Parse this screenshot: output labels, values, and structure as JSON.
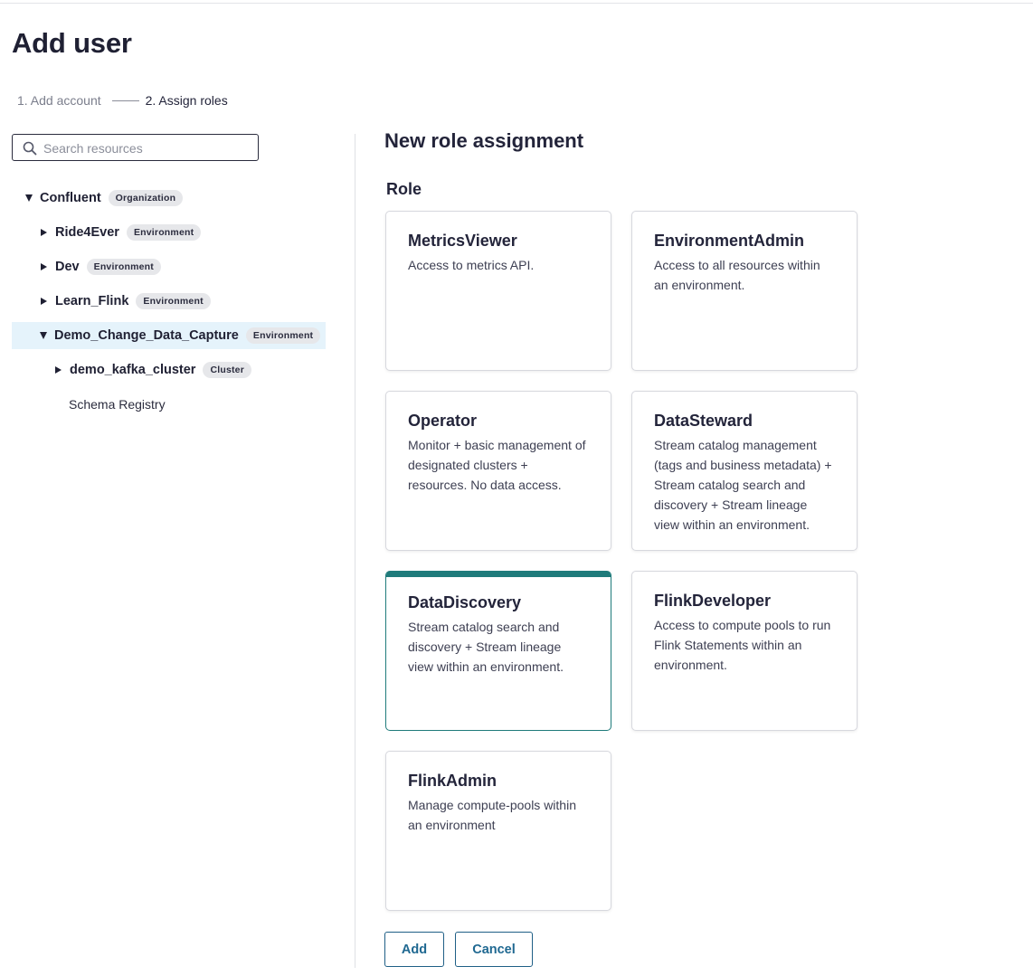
{
  "page": {
    "title": "Add user"
  },
  "stepper": {
    "step1": "1. Add account",
    "step2": "2. Assign roles"
  },
  "search": {
    "placeholder": "Search resources",
    "value": ""
  },
  "tree": [
    {
      "name": "Confluent",
      "badge": "Organization",
      "expanded": true
    },
    {
      "name": "Ride4Ever",
      "badge": "Environment",
      "expanded": false
    },
    {
      "name": "Dev",
      "badge": "Environment",
      "expanded": false
    },
    {
      "name": "Learn_Flink",
      "badge": "Environment",
      "expanded": false
    },
    {
      "name": "Demo_Change_Data_Capture",
      "badge": "Environment",
      "expanded": true,
      "selected": true
    },
    {
      "name": "demo_kafka_cluster",
      "badge": "Cluster",
      "expanded": false
    },
    {
      "name": "Schema Registry"
    }
  ],
  "main": {
    "title": "New role assignment",
    "role_label": "Role",
    "roles": [
      {
        "name": "MetricsViewer",
        "description": "Access to metrics API."
      },
      {
        "name": "EnvironmentAdmin",
        "description": "Access to all resources within an environment."
      },
      {
        "name": "Operator",
        "description": "Monitor + basic management of designated clusters + resources. No data access."
      },
      {
        "name": "DataSteward",
        "description": "Stream catalog management (tags and business metadata) + Stream catalog search and discovery + Stream lineage view within an environment."
      },
      {
        "name": "DataDiscovery",
        "description": "Stream catalog search and discovery + Stream lineage view within an environment.",
        "selected": true
      },
      {
        "name": "FlinkDeveloper",
        "description": "Access to compute pools to run Flink Statements within an environment."
      },
      {
        "name": "FlinkAdmin",
        "description": "Manage compute-pools within an environment"
      }
    ]
  },
  "actions": {
    "add_label": "Add",
    "cancel_label": "Cancel"
  },
  "colors": {
    "accent": "#1f7b7b",
    "selected_row": "#e5f3fb",
    "button_text": "#1f6891"
  }
}
